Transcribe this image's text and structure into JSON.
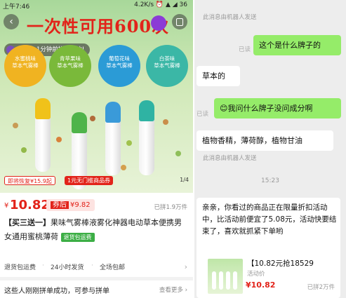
{
  "status_bar": {
    "time": "上午7:46",
    "indicators": "4.2K/s ⏰ ▲ ◢ 36"
  },
  "product_page": {
    "headline": "一次性可用600次",
    "buyer_toast": "晓*** 1分钟前拼单成功!",
    "circle_labels": [
      {
        "label": "水蜜桃味\n草本气雾棒",
        "color": "#f0b321"
      },
      {
        "label": "青苹果味\n草本气雾棒",
        "color": "#7ab93a"
      },
      {
        "label": "葡萄花味\n草本气雾棒",
        "color": "#2b9bd6"
      },
      {
        "label": "白茶味\n草本气雾棒",
        "color": "#3bb7a6"
      }
    ],
    "cap_colors": [
      "#f0c21a",
      "#4fb44a",
      "#3a9ad9",
      "#2fb3a3"
    ],
    "promo_tags": [
      "即将恢复¥15.9起",
      "1元无门槛商品券"
    ],
    "image_counter": "1/4",
    "price_symbol": "¥",
    "price": "10.82",
    "after_coupon_label": "券后",
    "after_coupon_price": "¥9.82",
    "sold": "已拼1.9万件",
    "title_highlight": "【买三送一】",
    "title_rest": "果味气雾棒液雾化神器电动草本便携男女通用蜜桃薄荷",
    "title_badge": "退货包运费",
    "services": [
      "退货包运费",
      "24小时发货",
      "全场包邮"
    ],
    "group_text": "这些人刚刚拼单成功，可参与拼单",
    "group_more": "查看更多 ›"
  },
  "chat": {
    "sys_note_text": "此消息由机器人发送",
    "read_label": "已读",
    "messages": [
      {
        "dir": "out",
        "text": "这个是什么牌子的"
      },
      {
        "dir": "in",
        "text": "草本的"
      },
      {
        "dir": "out",
        "text": "😊我问什么牌子没问成分啊"
      },
      {
        "dir": "in",
        "text": "植物香精，薄荷醇，植物甘油"
      }
    ],
    "time_divider": "15:23",
    "card_message": "亲亲，你看过的商品正在限量折扣活动中，比活动前便宜了5.08元，活动快要结束了，喜欢就抓紧下单哟",
    "card_title": "【10.82元抢18529",
    "card_sub": "活动价",
    "card_price": "¥10.82",
    "card_sold": "已拼2万件"
  }
}
